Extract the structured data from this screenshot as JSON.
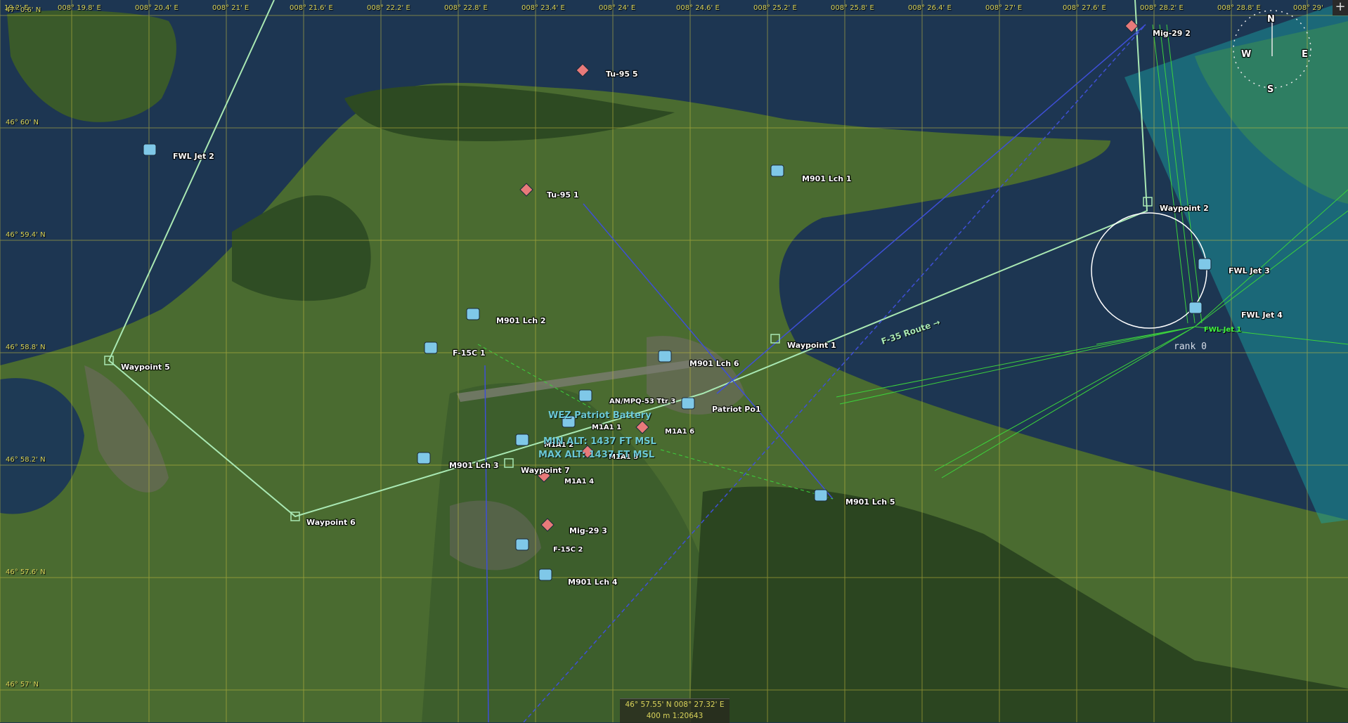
{
  "grid": {
    "lon_labels": [
      "19.2' E",
      "008° 19.8' E",
      "008° 20.4' E",
      "008° 21' E",
      "008° 21.6' E",
      "008° 22.2' E",
      "008° 22.8' E",
      "008° 23.4' E",
      "008° 24' E",
      "008° 24.6' E",
      "008° 25.2' E",
      "008° 25.8' E",
      "008° 26.4' E",
      "008° 27' E",
      "008° 27.6' E",
      "008° 28.2' E",
      "008° 28.8' E",
      "008° 29'"
    ],
    "lat_labels": [
      "47° 0.6' N",
      "46° 60' N",
      "46° 59.4' N",
      "46° 58.8' N",
      "46° 58.2' N",
      "46° 57.6' N",
      "46° 57' N"
    ]
  },
  "units": [
    {
      "name": "fwl-jet-2",
      "label": "FWL Jet 2",
      "side": "blue"
    },
    {
      "name": "tu95-5",
      "label": "Tu-95 5",
      "side": "red"
    },
    {
      "name": "tu95-1",
      "label": "Tu-95 1",
      "side": "red"
    },
    {
      "name": "m901-lch-1",
      "label": "M901 Lch 1",
      "side": "blue"
    },
    {
      "name": "m901-lch-2",
      "label": "M901 Lch 2",
      "side": "blue"
    },
    {
      "name": "f15c-1",
      "label": "F-15C 1",
      "side": "blue"
    },
    {
      "name": "m901-lch-6",
      "label": "M901 Lch 6",
      "side": "blue"
    },
    {
      "name": "an-mpq",
      "label": "AN/MPQ-53 Ttr 3",
      "side": "blue"
    },
    {
      "name": "patriot-po1",
      "label": "Patriot Po1",
      "side": "blue"
    },
    {
      "name": "m1a1-1",
      "label": "M1A1 1",
      "side": "blue"
    },
    {
      "name": "m1a1-2",
      "label": "M1A1 2",
      "side": "blue"
    },
    {
      "name": "m1a1-6",
      "label": "M1A1 6",
      "side": "red"
    },
    {
      "name": "m1a1-5",
      "label": "M1A1 5",
      "side": "red"
    },
    {
      "name": "m1a1-4",
      "label": "M1A1 4",
      "side": "red"
    },
    {
      "name": "m901-lch-3",
      "label": "M901 Lch 3",
      "side": "blue"
    },
    {
      "name": "m901-lch-5",
      "label": "M901 Lch 5",
      "side": "blue"
    },
    {
      "name": "mig29-3",
      "label": "Mig-29 3",
      "side": "red"
    },
    {
      "name": "f15c-2",
      "label": "F-15C 2",
      "side": "blue"
    },
    {
      "name": "m901-lch-4",
      "label": "M901 Lch 4",
      "side": "blue"
    },
    {
      "name": "mig29-2",
      "label": "Mig-29 2",
      "side": "red"
    },
    {
      "name": "fwl-jet-3",
      "label": "FWL Jet 3",
      "side": "blue"
    },
    {
      "name": "fwl-jet-4",
      "label": "FWL Jet 4",
      "side": "blue"
    }
  ],
  "waypoints": [
    {
      "name": "waypoint-1",
      "label": "Waypoint 1"
    },
    {
      "name": "waypoint-2",
      "label": "Waypoint 2"
    },
    {
      "name": "waypoint-5",
      "label": "Waypoint 5"
    },
    {
      "name": "waypoint-6",
      "label": "Waypoint 6"
    },
    {
      "name": "waypoint-7",
      "label": "Waypoint 7"
    }
  ],
  "route_label": "F-35 Route →",
  "wez": {
    "title": "WEZ Patriot Battery",
    "min_alt": "MIN ALT: 1437 FT MSL",
    "max_alt": "MAX ALT: 1437 FT MSL"
  },
  "fwl_jet_1": "FWL Jet 1",
  "rank_label": "rank 0",
  "compass": {
    "n": "N",
    "e": "E",
    "s": "S",
    "w": "W"
  },
  "status": {
    "coords": "46° 57.55' N  008° 27.32' E",
    "scale": "400 m   1:20643"
  },
  "corner_button": "+",
  "colors": {
    "blue_side": "#7fc8e8",
    "red_side": "#e87a7a",
    "grid": "#c8c040",
    "route": "#a9e8b3",
    "wez_fill": "#1aa6a6"
  }
}
